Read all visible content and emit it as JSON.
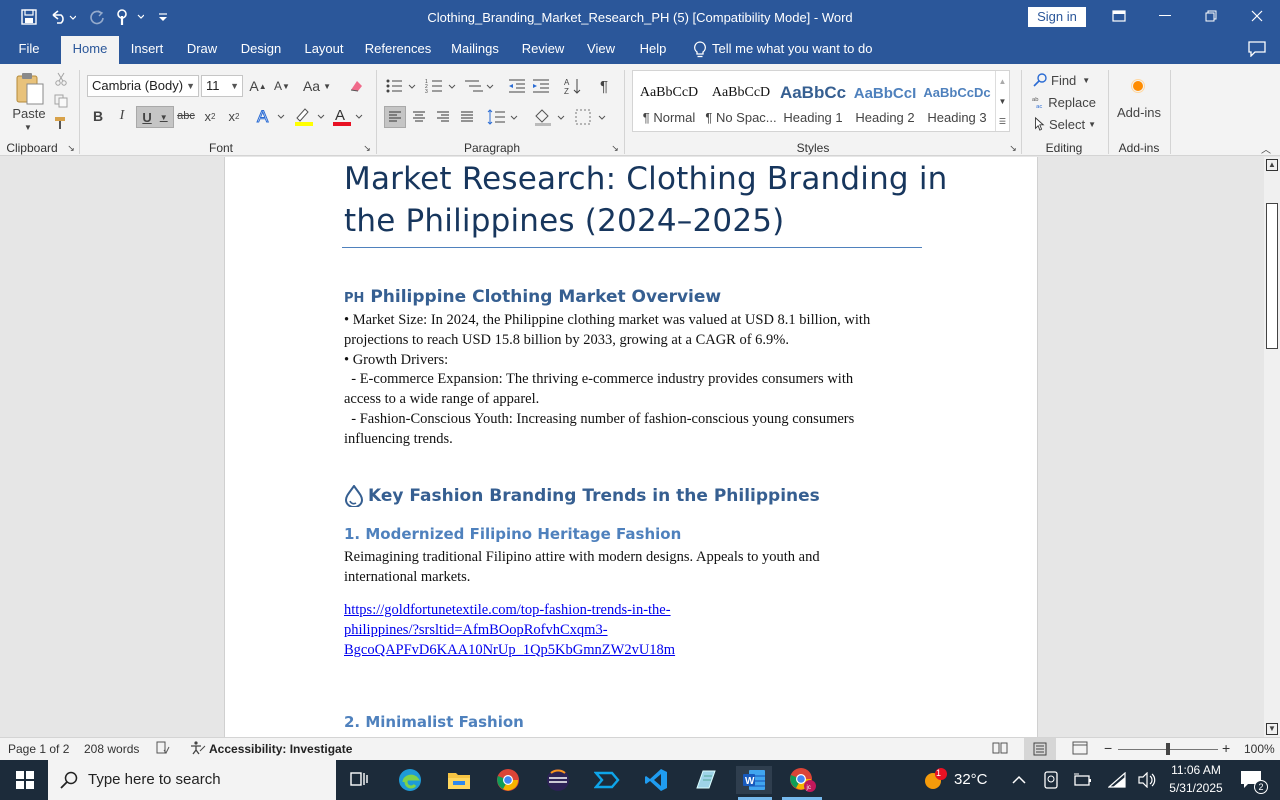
{
  "window": {
    "title": "Clothing_Branding_Market_Research_PH (5) [Compatibility Mode]  -  Word",
    "sign_in": "Sign in"
  },
  "tabs": [
    "File",
    "Home",
    "Insert",
    "Draw",
    "Design",
    "Layout",
    "References",
    "Mailings",
    "Review",
    "View",
    "Help"
  ],
  "tell_me": "Tell me what you want to do",
  "ribbon": {
    "clipboard": {
      "paste": "Paste",
      "label": "Clipboard"
    },
    "font": {
      "name": "Cambria (Body)",
      "size": "11",
      "label": "Font",
      "aa": "Aa"
    },
    "paragraph": {
      "label": "Paragraph"
    },
    "styles": {
      "label": "Styles",
      "items": [
        {
          "sample": "AaBbCcD",
          "name": "¶ Normal"
        },
        {
          "sample": "AaBbCcD",
          "name": "¶ No Spac..."
        },
        {
          "sample": "AaBbCc",
          "name": "Heading 1"
        },
        {
          "sample": "AaBbCcI",
          "name": "Heading 2"
        },
        {
          "sample": "AaBbCcDc",
          "name": "Heading 3"
        }
      ]
    },
    "editing": {
      "find": "Find",
      "replace": "Replace",
      "select": "Select",
      "label": "Editing"
    },
    "addins": {
      "button": "Add-ins",
      "label": "Add-ins"
    }
  },
  "document": {
    "title_line1": "Market Research: Clothing Branding in",
    "title_line2": "the Philippines (2024–2025)",
    "overview_prefix": "PH",
    "overview_heading": "Philippine Clothing Market Overview",
    "overview_lines": [
      "• Market Size: In 2024, the Philippine clothing market was valued at USD 8.1 billion, with",
      "projections to reach USD 15.8 billion by 2033, growing at a CAGR of 6.9%.",
      "• Growth Drivers:",
      "  - E-commerce Expansion: The thriving e-commerce industry provides consumers with",
      "access to a wide range of apparel.",
      "  - Fashion-Conscious Youth: Increasing number of fashion-conscious young consumers",
      "influencing trends."
    ],
    "trends_heading": "Key Fashion Branding Trends in the Philippines",
    "trend1_heading": "1. Modernized Filipino Heritage Fashion",
    "trend1_lines": [
      "Reimagining traditional Filipino attire with modern designs. Appeals to youth and",
      "international markets."
    ],
    "trend1_link_lines": [
      "https://goldfortunetextile.com/top-fashion-trends-in-the-",
      "philippines/?srsltid=AfmBOopRofvhCxqm3-",
      "BgcoQAPFvD6KAA10NrUp_1Qp5KbGmnZW2vU18m"
    ],
    "trend2_heading": "2. Minimalist Fashion"
  },
  "status": {
    "page": "Page 1 of 2",
    "words": "208 words",
    "accessibility": "Accessibility: Investigate",
    "zoom": "100%"
  },
  "taskbar": {
    "search_placeholder": "Type here to search",
    "temperature": "32°C",
    "weather_badge": "1",
    "time": "11:06 AM",
    "date": "5/31/2025",
    "notifications": "2"
  },
  "colors": {
    "word_blue": "#2b579a",
    "heading_dark": "#17365d",
    "heading_blue": "#365f91",
    "link": "#0000ee"
  }
}
